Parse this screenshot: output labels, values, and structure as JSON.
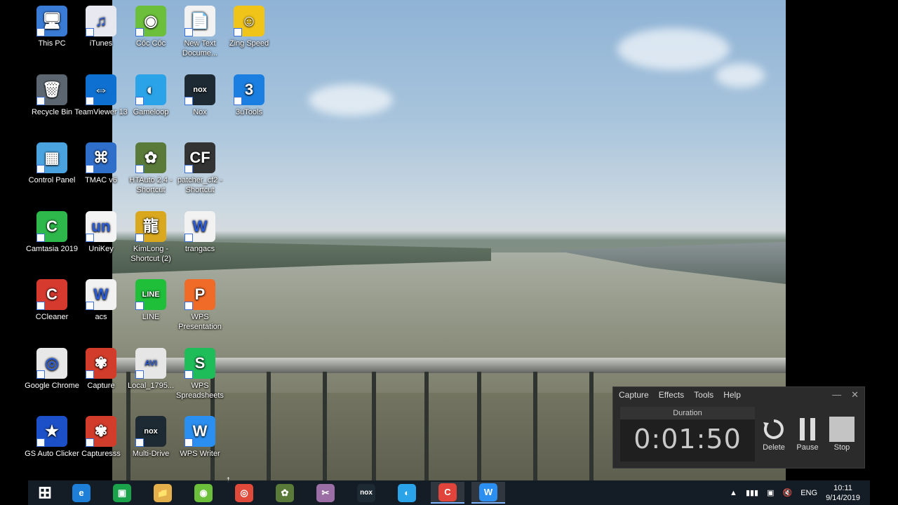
{
  "desktop_icons": [
    {
      "label": "This PC",
      "col": 0,
      "row": 0,
      "color": "#3a7bd5",
      "glyph": "🖥"
    },
    {
      "label": "iTunes",
      "col": 1,
      "row": 0,
      "color": "#e8e8f0",
      "glyph": "♫"
    },
    {
      "label": "Cốc Cốc",
      "col": 2,
      "row": 0,
      "color": "#6cbf3b",
      "glyph": "◉"
    },
    {
      "label": "New Text Docume...",
      "col": 3,
      "row": 0,
      "color": "#f2f2f2",
      "glyph": "📄"
    },
    {
      "label": "Zing Speed",
      "col": 4,
      "row": 0,
      "color": "#f0c419",
      "glyph": "☺"
    },
    {
      "label": "Recycle Bin",
      "col": 0,
      "row": 1,
      "color": "#5c6670",
      "glyph": "🗑"
    },
    {
      "label": "TeamViewer 13",
      "col": 1,
      "row": 1,
      "color": "#0e71d2",
      "glyph": "⇔"
    },
    {
      "label": "Gameloop",
      "col": 2,
      "row": 1,
      "color": "#2aa3e8",
      "glyph": "◐"
    },
    {
      "label": "Nox",
      "col": 3,
      "row": 1,
      "color": "#1d2a33",
      "glyph": "nox"
    },
    {
      "label": "3uTools",
      "col": 4,
      "row": 1,
      "color": "#1a7fe0",
      "glyph": "3"
    },
    {
      "label": "Control Panel",
      "col": 0,
      "row": 2,
      "color": "#4aa3df",
      "glyph": "▦"
    },
    {
      "label": "TMAC v6",
      "col": 1,
      "row": 2,
      "color": "#2f6ec9",
      "glyph": "⌘"
    },
    {
      "label": "HTAuto 2.4 - Shortcut",
      "col": 2,
      "row": 2,
      "color": "#5a7a3a",
      "glyph": "✿"
    },
    {
      "label": "patcher_cf2 - Shortcut",
      "col": 3,
      "row": 2,
      "color": "#333",
      "glyph": "CF"
    },
    {
      "label": "Camtasia 2019",
      "col": 0,
      "row": 3,
      "color": "#2eb84b",
      "glyph": "C"
    },
    {
      "label": "UniKey",
      "col": 1,
      "row": 3,
      "color": "#f4f4f4",
      "glyph": "un"
    },
    {
      "label": "KimLong - Shortcut (2)",
      "col": 2,
      "row": 3,
      "color": "#d9a81f",
      "glyph": "龍"
    },
    {
      "label": "trangacs",
      "col": 3,
      "row": 3,
      "color": "#f2f2f2",
      "glyph": "W"
    },
    {
      "label": "CCleaner",
      "col": 0,
      "row": 4,
      "color": "#d63a2f",
      "glyph": "C"
    },
    {
      "label": "acs",
      "col": 1,
      "row": 4,
      "color": "#f2f2f2",
      "glyph": "W"
    },
    {
      "label": "LINE",
      "col": 2,
      "row": 4,
      "color": "#1fbf3a",
      "glyph": "LINE"
    },
    {
      "label": "WPS Presentation",
      "col": 3,
      "row": 4,
      "color": "#f06a28",
      "glyph": "P"
    },
    {
      "label": "Google Chrome",
      "col": 0,
      "row": 5,
      "color": "#e8e8e8",
      "glyph": "◎"
    },
    {
      "label": "Capture",
      "col": 1,
      "row": 5,
      "color": "#d23c2a",
      "glyph": "✾"
    },
    {
      "label": "Local_1795...",
      "col": 2,
      "row": 5,
      "color": "#e6e6e6",
      "glyph": "AVI"
    },
    {
      "label": "WPS Spreadsheets",
      "col": 3,
      "row": 5,
      "color": "#1ebd5a",
      "glyph": "S"
    },
    {
      "label": "GS Auto Clicker",
      "col": 0,
      "row": 6,
      "color": "#1c50c9",
      "glyph": "★"
    },
    {
      "label": "Capturesss",
      "col": 1,
      "row": 6,
      "color": "#d23c2a",
      "glyph": "✾"
    },
    {
      "label": "Multi-Drive",
      "col": 2,
      "row": 6,
      "color": "#1d2a33",
      "glyph": "nox"
    },
    {
      "label": "WPS Writer",
      "col": 3,
      "row": 6,
      "color": "#2a8ff0",
      "glyph": "W"
    }
  ],
  "taskbar": {
    "items": [
      {
        "name": "start",
        "glyph": "⊞",
        "color": "transparent"
      },
      {
        "name": "internet-explorer",
        "glyph": "e",
        "color": "#1d7fd8"
      },
      {
        "name": "store",
        "glyph": "▣",
        "color": "#1aa34a"
      },
      {
        "name": "file-explorer",
        "glyph": "📁",
        "color": "#e3b04b"
      },
      {
        "name": "coc-coc",
        "glyph": "◉",
        "color": "#6cbf3b"
      },
      {
        "name": "chrome",
        "glyph": "◎",
        "color": "#e04a3a"
      },
      {
        "name": "htauto",
        "glyph": "✿",
        "color": "#5a7a3a"
      },
      {
        "name": "capture-tool",
        "glyph": "✂",
        "color": "#9b6fa6"
      },
      {
        "name": "nox",
        "glyph": "nox",
        "color": "#1d2a33"
      },
      {
        "name": "gameloop",
        "glyph": "◐",
        "color": "#2aa3e8"
      },
      {
        "name": "camtasia",
        "glyph": "C",
        "color": "#e0443a"
      },
      {
        "name": "wps-writer",
        "glyph": "W",
        "color": "#2a8ff0"
      }
    ],
    "language": "ENG",
    "time": "10:11",
    "date": "9/14/2019"
  },
  "recorder": {
    "menu": [
      "Capture",
      "Effects",
      "Tools",
      "Help"
    ],
    "duration_label": "Duration",
    "duration": "0:01:50",
    "buttons": [
      {
        "label": "Delete",
        "icon": "undo-icon"
      },
      {
        "label": "Pause",
        "icon": "pause-icon"
      },
      {
        "label": "Stop",
        "icon": "stop-icon"
      }
    ]
  }
}
